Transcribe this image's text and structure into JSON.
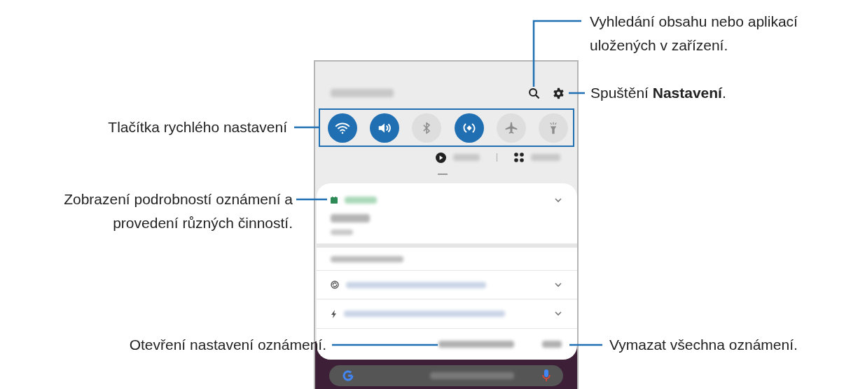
{
  "callouts": [
    {
      "kind": "search",
      "lines": [
        "Vyhledání obsahu nebo aplikací",
        "uložených v zařízení."
      ]
    },
    {
      "kind": "settings",
      "lines": [
        "Spuštění **Nastavení**."
      ]
    },
    {
      "kind": "toggles",
      "lines": [
        "Tlačítka rychlého nastavení"
      ]
    },
    {
      "kind": "notification",
      "lines": [
        "Zobrazení podrobností oznámení a",
        "provedení různých činností."
      ]
    },
    {
      "kind": "notif-settings",
      "lines": [
        "Otevření nastavení oznámení."
      ]
    },
    {
      "kind": "clear",
      "lines": [
        "Vymazat všechna oznámení."
      ]
    }
  ],
  "toggles": [
    {
      "kind": "wifi",
      "on": true
    },
    {
      "kind": "sound",
      "on": true
    },
    {
      "kind": "bluetooth",
      "on": false
    },
    {
      "kind": "sync",
      "on": true
    },
    {
      "kind": "airplane",
      "on": false
    },
    {
      "kind": "flashlight",
      "on": false
    }
  ]
}
